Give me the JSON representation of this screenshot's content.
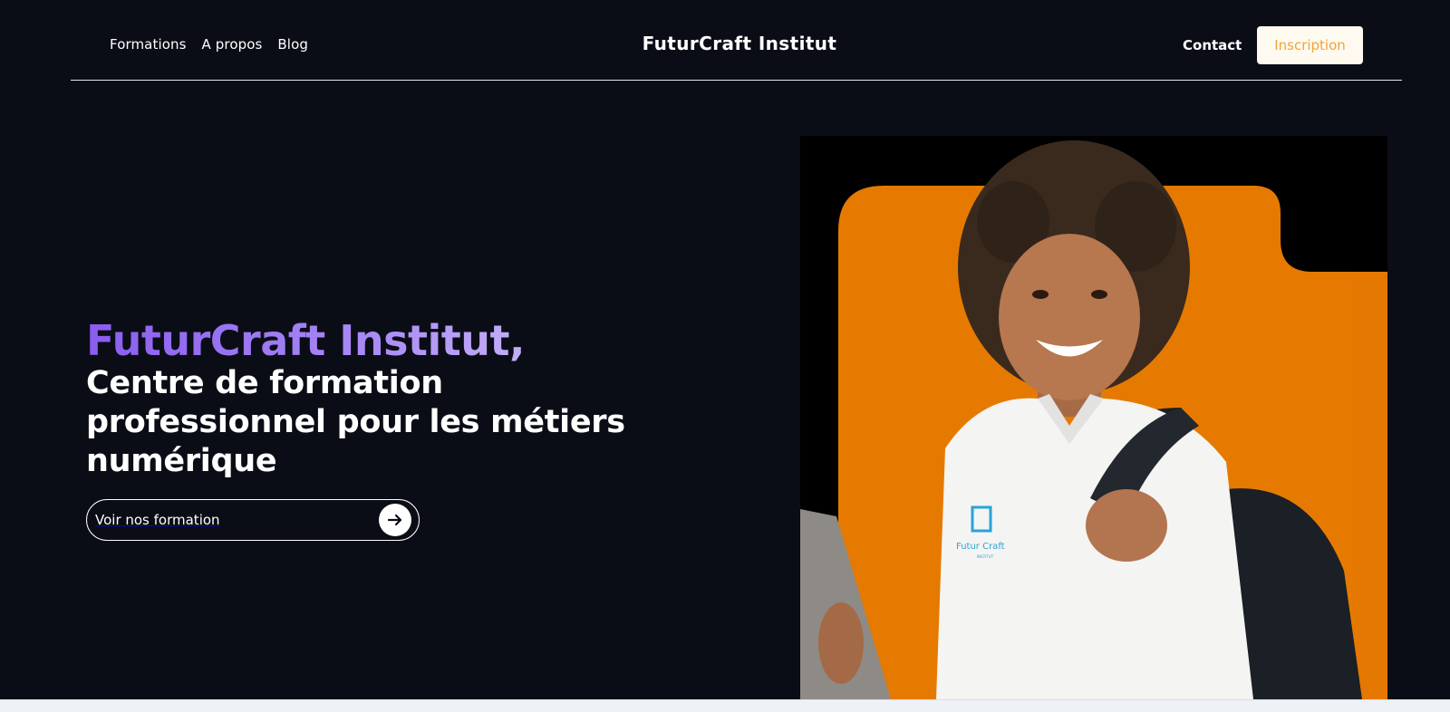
{
  "header": {
    "nav": [
      {
        "label": "Formations"
      },
      {
        "label": "A propos"
      },
      {
        "label": "Blog"
      }
    ],
    "brand": "FuturCraft Institut",
    "contact_label": "Contact",
    "inscription_label": "Inscription"
  },
  "hero": {
    "title": "FuturCraft Institut,",
    "subtitle": "Centre de formation professionnel pour les métiers numérique",
    "cta_label": "Voir nos formation",
    "cta_icon": "arrow-right-icon"
  },
  "image": {
    "shirt_logo": "Futur Craft",
    "shirt_logo_small": "INSTITUT"
  },
  "colors": {
    "background": "#0a0d16",
    "accent_orange": "#e67a00",
    "title_gradient_start": "#8a5cf0",
    "title_gradient_end": "#e4dcfb",
    "inscription_text": "#f2a33a",
    "inscription_bg": "#fffaf0"
  }
}
